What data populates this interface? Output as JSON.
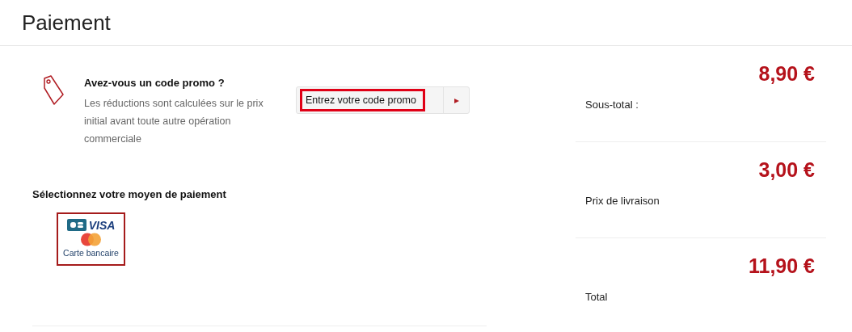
{
  "page_title": "Paiement",
  "promo": {
    "heading": "Avez-vous un code promo ?",
    "description": "Les réductions sont calculées sur le prix initial avant toute autre opération commerciale",
    "field": {
      "placeholder": "Entrez votre code promo",
      "highlighted": true
    },
    "submit_symbol": "▸"
  },
  "payment": {
    "heading": "Sélectionnez votre moyen de paiement",
    "methods": [
      {
        "label": "Carte bancaire",
        "logo_text": "VISA",
        "selected": true
      }
    ]
  },
  "summary": [
    {
      "label": "Sous-total :",
      "amount": "8,90 €"
    },
    {
      "label": "Prix de livraison",
      "amount": "3,00 €"
    },
    {
      "label": "Total",
      "amount": "11,90 €"
    }
  ]
}
